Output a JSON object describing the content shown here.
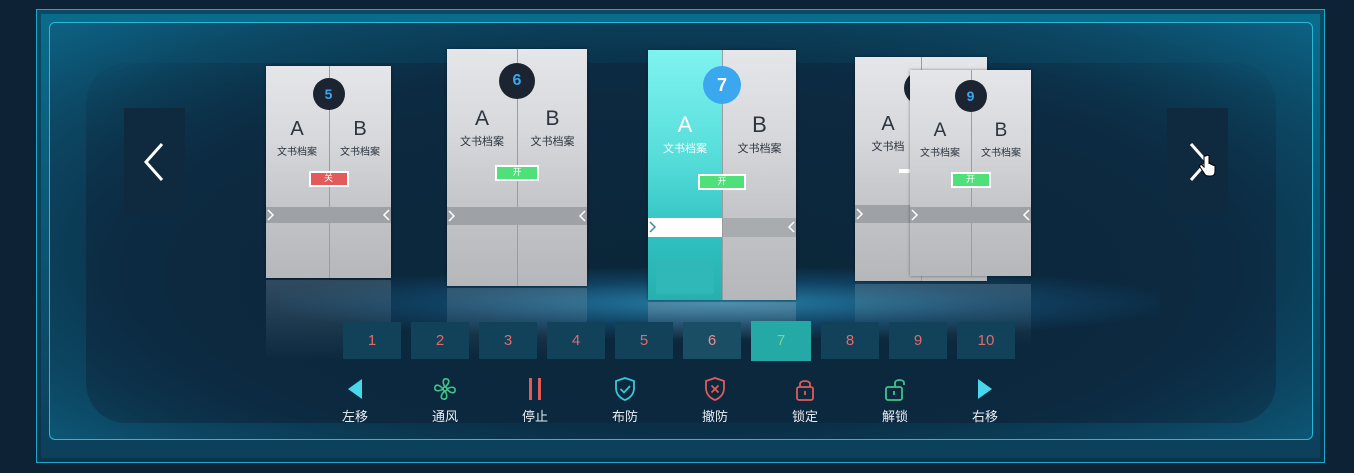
{
  "cabinets": [
    {
      "number": "5",
      "left_letter": "A",
      "right_letter": "B",
      "left_label": "文书档案",
      "right_label": "文书档案",
      "status": "关",
      "status_color": "#e35a5a"
    },
    {
      "number": "6",
      "left_letter": "A",
      "right_letter": "B",
      "left_label": "文书档案",
      "right_label": "文书档案",
      "status": "开",
      "status_color": "#4fe07a"
    },
    {
      "number": "7",
      "left_letter": "A",
      "right_letter": "B",
      "left_label": "文书档案",
      "right_label": "文书档案",
      "status": "开",
      "status_color": "#4fe07a"
    },
    {
      "number": "8",
      "left_letter": "A",
      "right_letter": "B",
      "left_label": "文书档",
      "right_label": "",
      "status": "",
      "status_color": "#e35a5a"
    },
    {
      "number": "9",
      "left_letter": "A",
      "right_letter": "B",
      "left_label": "文书档案",
      "right_label": "文书档案",
      "status": "开",
      "status_color": "#4fe07a"
    }
  ],
  "pagination": [
    "1",
    "2",
    "3",
    "4",
    "5",
    "6",
    "7",
    "8",
    "9",
    "10"
  ],
  "active_page": "7",
  "toolbar": [
    {
      "label": "左移",
      "icon": "triangle-left-icon",
      "color": "#49d7ea"
    },
    {
      "label": "通风",
      "icon": "fan-icon",
      "color": "#42c48a"
    },
    {
      "label": "停止",
      "icon": "pause-icon",
      "color": "#e25a5a"
    },
    {
      "label": "布防",
      "icon": "shield-check-icon",
      "color": "#3ac7d8"
    },
    {
      "label": "撤防",
      "icon": "shield-x-icon",
      "color": "#e25a5a"
    },
    {
      "label": "锁定",
      "icon": "lock-icon",
      "color": "#e25a5a"
    },
    {
      "label": "解锁",
      "icon": "unlock-icon",
      "color": "#42c48a"
    },
    {
      "label": "右移",
      "icon": "triangle-right-icon",
      "color": "#49d7ea"
    }
  ],
  "colors": {
    "active_cabinet": "#5ee7e4",
    "number_badge": "#3aa7ee",
    "accent": "#1fa7c9"
  }
}
